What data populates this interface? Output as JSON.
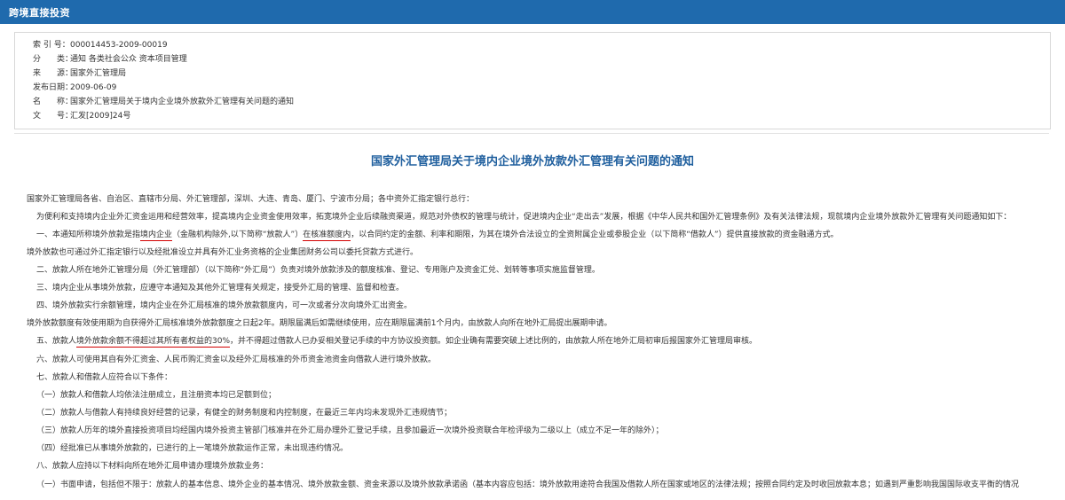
{
  "header": {
    "title": "跨境直接投资"
  },
  "meta": [
    {
      "label": "索 引 号：",
      "value": "000014453-2009-00019"
    },
    {
      "label": "分　　类：",
      "value": "通知  各类社会公众  资本项目管理"
    },
    {
      "label": "来　　源：",
      "value": "国家外汇管理局"
    },
    {
      "label": "发布日期：",
      "value": "2009-06-09"
    },
    {
      "label": "名　　称：",
      "value": "国家外汇管理局关于境内企业境外放款外汇管理有关问题的通知"
    },
    {
      "label": "文　　号：",
      "value": "汇发[2009]24号"
    }
  ],
  "document": {
    "title": "国家外汇管理局关于境内企业境外放款外汇管理有关问题的通知",
    "para1": "国家外汇管理局各省、自治区、直辖市分局、外汇管理部，深圳、大连、青岛、厦门、宁波市分局；各中资外汇指定银行总行：",
    "para2": "为便利和支持境内企业外汇资金运用和经营效率，提高境内企业资金使用效率，拓宽境外企业后续融资渠道，规范对外债权的管理与统计，促进境内企业“走出去”发展，根据《中华人民共和国外汇管理条例》及有关法律法规，现就境内企业境外放款外汇管理有关问题通知如下：",
    "item1_a": "一、本通知所称境外放款是指",
    "item1_b": "境内企业",
    "item1_c": "（金融机构除外,以下简称“放款人”）",
    "item1_d": "在核准额度内",
    "item1_e": "，以合同约定的金额、利率和期限，为其在境外合法设立的全资附属企业或参股企业（以下简称“借款人”）提供直接放款的资金融通方式。",
    "para3": "境外放款也可通过外汇指定银行以及经批准设立并具有外汇业务资格的企业集团财务公司以委托贷款方式进行。",
    "item2": "二、放款人所在地外汇管理分局（外汇管理部）（以下简称“外汇局”）负责对境外放款涉及的额度核准、登记、专用账户及资金汇兑、划转等事项实施监督管理。",
    "item3": "三、境内企业从事境外放款，应遵守本通知及其他外汇管理有关规定，接受外汇局的管理、监督和检查。",
    "item4": "四、境外放款实行余额管理，境内企业在外汇局核准的境外放款额度内，可一次或者分次向境外汇出资金。",
    "para4": "境外放款额度有效使用期为自获得外汇局核准境外放款额度之日起2年。期限届满后如需继续使用，应在期限届满前1个月内，由放款人向所在地外汇局提出展期申请。",
    "item5_a": "五、放款人",
    "item5_b": "境外放款余额不得超过其所有者权益的30%",
    "item5_c": "，并不得超过借款人已办妥相关登记手续的中方协议投资额。如企业确有需要突破上述比例的，由放款人所在地外汇局初审后报国家外汇管理局审核。",
    "item6": "六、放款人可使用其自有外汇资金、人民币购汇资金以及经外汇局核准的外币资金池资金向借款人进行境外放款。",
    "item7": "七、放款人和借款人应符合以下条件：",
    "cond1": "（一）放款人和借款人均依法注册成立，且注册资本均已足额到位；",
    "cond2": "（二）放款人与借款人有持续良好经营的记录，有健全的财务制度和内控制度，在最近三年内均未发现外汇违规情节；",
    "cond3": "（三）放款人历年的境外直接投资项目均经国内境外投资主管部门核准并在外汇局办理外汇登记手续，且参加最近一次境外投资联合年检评级为二级以上（成立不足一年的除外）；",
    "cond4": "（四）经批准已从事境外放款的，已进行的上一笔境外放款运作正常，未出现违约情况。",
    "item8": "八、放款人应持以下材料向所在地外汇局申请办理境外放款业务：",
    "app1": "（一）书面申请，包括但不限于：放款人的基本信息、境外企业的基本情况、境外放款金额、资金来源以及境外放款承诺函（基本内容应包括：境外放款用途符合我国及借款人所在国家或地区的法律法规；按照合同约定及时收回放款本息；如遇到严重影响我国国际收支平衡的情况"
  }
}
